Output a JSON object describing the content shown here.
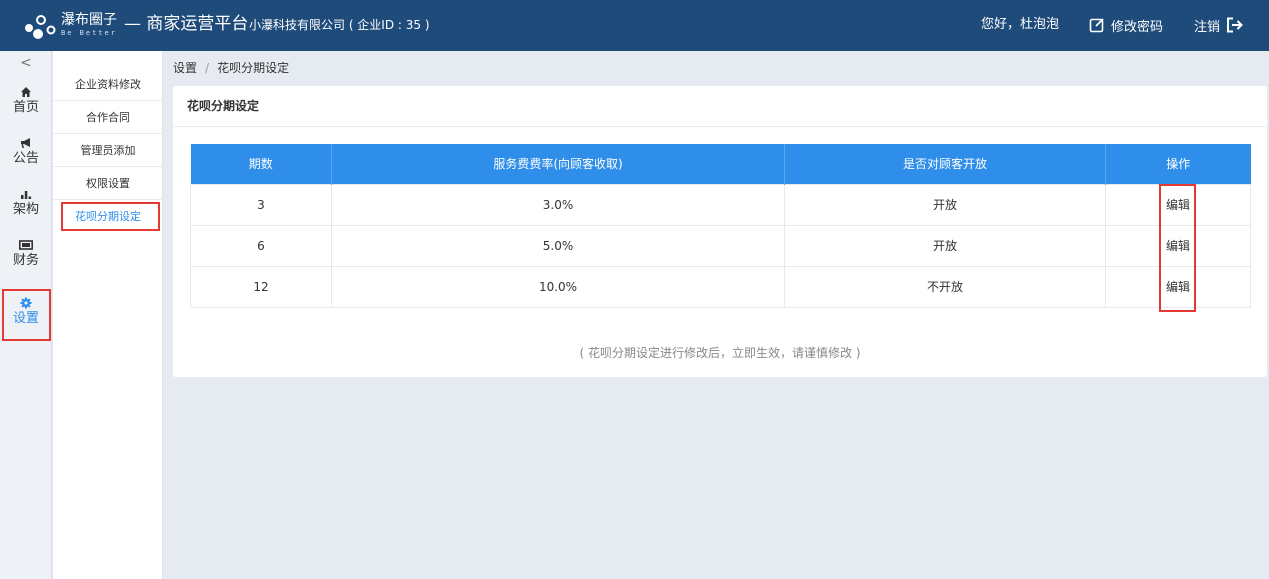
{
  "header": {
    "logo_text": "瀑布圈子",
    "logo_sub": "Be Better",
    "platform": "— 商家运营平台",
    "company": "小瀑科技有限公司 ( 企业ID : 35 )",
    "greeting": "您好，杜泡泡",
    "change_password": "修改密码",
    "logout": "注销"
  },
  "rail": {
    "collapse": "<",
    "items": [
      {
        "label": "首页",
        "icon": "home-icon"
      },
      {
        "label": "公告",
        "icon": "megaphone-icon"
      },
      {
        "label": "架构",
        "icon": "org-chart-icon"
      },
      {
        "label": "财务",
        "icon": "money-icon"
      },
      {
        "label": "设置",
        "icon": "gear-icon"
      }
    ]
  },
  "submenu": {
    "items": [
      {
        "label": "企业资料修改"
      },
      {
        "label": "合作合同"
      },
      {
        "label": "管理员添加"
      },
      {
        "label": "权限设置"
      },
      {
        "label": "花呗分期设定"
      }
    ]
  },
  "breadcrumb": {
    "root": "设置",
    "separator": "/",
    "current": "花呗分期设定"
  },
  "card": {
    "title": "花呗分期设定",
    "note": "( 花呗分期设定进行修改后，立即生效，请谨慎修改 )"
  },
  "table": {
    "headers": [
      "期数",
      "服务费费率(向顾客收取)",
      "是否对顾客开放",
      "操作"
    ],
    "rows": [
      {
        "period": "3",
        "rate": "3.0%",
        "open": "开放",
        "action": "编辑"
      },
      {
        "period": "6",
        "rate": "5.0%",
        "open": "开放",
        "action": "编辑"
      },
      {
        "period": "12",
        "rate": "10.0%",
        "open": "不开放",
        "action": "编辑"
      }
    ]
  },
  "colors": {
    "header_bg": "#1f4b7b",
    "accent": "#2f8ee9",
    "highlight": "#e53935"
  }
}
